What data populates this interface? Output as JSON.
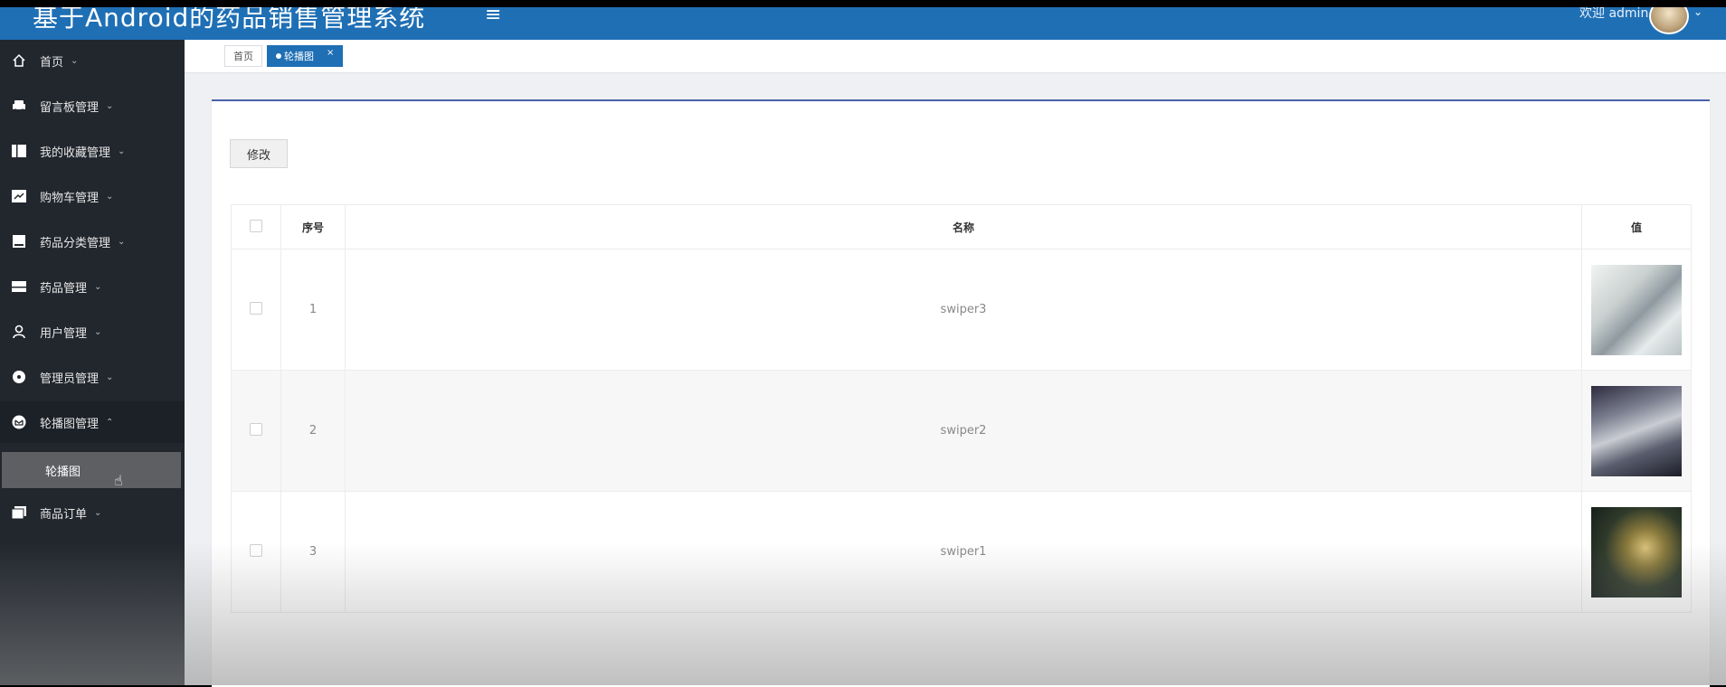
{
  "header": {
    "title": "基于Android的药品销售管理系统",
    "menu_icon": "hamburger-icon",
    "welcome": "欢迎 admin",
    "user_caret": "⌄"
  },
  "sidebar": {
    "items": [
      {
        "label": "首页",
        "icon": "home-icon",
        "caret": "⌄"
      },
      {
        "label": "留言板管理",
        "icon": "car-icon",
        "caret": "⌄"
      },
      {
        "label": "我的收藏管理",
        "icon": "book-icon",
        "caret": "⌄"
      },
      {
        "label": "购物车管理",
        "icon": "chart-icon",
        "caret": "⌄"
      },
      {
        "label": "药品分类管理",
        "icon": "folder-icon",
        "caret": "⌄"
      },
      {
        "label": "药品管理",
        "icon": "drawer-icon",
        "caret": "⌄"
      },
      {
        "label": "用户管理",
        "icon": "user-icon",
        "caret": "⌄"
      },
      {
        "label": "管理员管理",
        "icon": "record-icon",
        "caret": "⌄"
      },
      {
        "label": "轮播图管理",
        "icon": "mail-icon",
        "caret": "⌃"
      },
      {
        "label": "商品订单",
        "icon": "files-icon",
        "caret": "⌄"
      }
    ],
    "submenu": {
      "label": "轮播图"
    }
  },
  "tabs": [
    {
      "label": "首页",
      "active": false
    },
    {
      "label": "轮播图",
      "active": true,
      "close": "×"
    }
  ],
  "toolbar": {
    "edit_label": "修改"
  },
  "table": {
    "headers": {
      "index": "序号",
      "name": "名称",
      "value": "值"
    },
    "rows": [
      {
        "index": "1",
        "name": "swiper3"
      },
      {
        "index": "2",
        "name": "swiper2"
      },
      {
        "index": "3",
        "name": "swiper1"
      }
    ]
  },
  "colors": {
    "primary": "#1f6fb5",
    "sidebar": "#22272e",
    "submenu_active": "#5d5f63"
  }
}
